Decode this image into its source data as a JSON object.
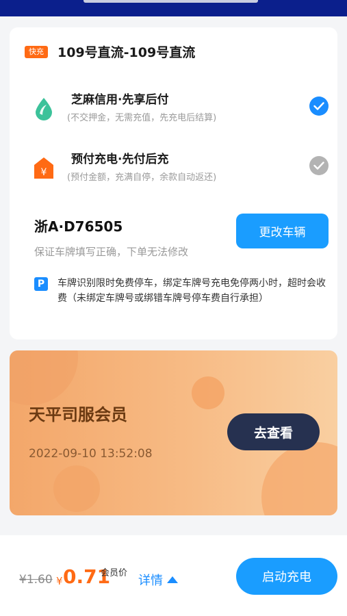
{
  "station": {
    "tag": "快充",
    "name": "109号直流-109号直流"
  },
  "payment_options": [
    {
      "title": "芝麻信用·先享后付",
      "desc": "(不交押金，无需充值，先充电后结算)",
      "icon": "sesame-credit-icon",
      "selected": true
    },
    {
      "title": "预付充电·先付后充",
      "desc": "(预付金额，充满自停，余款自动返还)",
      "icon": "prepaid-yen-icon",
      "selected": false
    }
  ],
  "vehicle": {
    "plate": "浙A·D76505",
    "hint": "保证车牌填写正确，下单无法修改",
    "change_label": "更改车辆"
  },
  "parking": {
    "icon_label": "P",
    "text": "车牌识别限时免费停车，绑定车牌号充电免停两小时，超时会收费（未绑定车牌号或绑错车牌号停车费自行承担）"
  },
  "member": {
    "title": "天平司服会员",
    "datetime": "2022-09-10   13:52:08",
    "view_label": "去查看"
  },
  "footer": {
    "original_price": "¥1.60",
    "currency": "¥",
    "price": "0.71",
    "price_label": "会员价",
    "detail_label": "详情",
    "start_label": "启动充电"
  },
  "colors": {
    "accent": "#1a9dff",
    "orange": "#ff6a14",
    "topbar": "#0b1f8c",
    "member_button": "#263150"
  }
}
